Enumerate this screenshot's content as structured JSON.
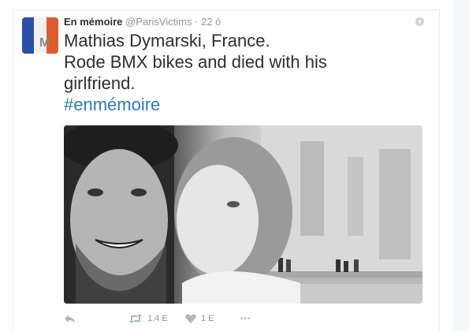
{
  "tweet": {
    "display_name": "En mémoire",
    "handle": "@ParisVictims",
    "separator": "·",
    "time": "22 ó",
    "avatar_letter": "M",
    "text_lines": [
      "Mathias Dymarski, France.",
      "Rode BMX bikes and died with his",
      "girlfriend."
    ],
    "hashtag": "#enmémoire"
  },
  "actions": {
    "retweet_count": "1,4 E",
    "like_count": "1 E",
    "more_label": "•••"
  },
  "colors": {
    "text": "#292f33",
    "muted": "#8899a6",
    "link": "#2b7bb9",
    "flag_blue": "#2b4fa6",
    "flag_red": "#e05a2c"
  }
}
